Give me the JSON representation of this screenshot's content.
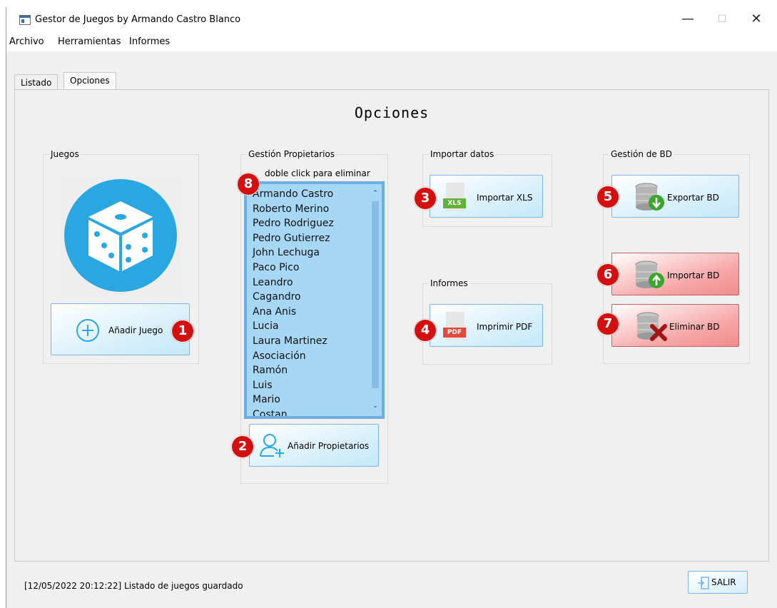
{
  "window": {
    "title": "Gestor de Juegos by Armando Castro Blanco",
    "minimize_glyph": "—",
    "maximize_glyph": "☐",
    "close_glyph": "✕"
  },
  "menu": [
    "Archivo",
    "Herramientas",
    "Informes"
  ],
  "tabs": [
    {
      "label": "Listado",
      "active": false
    },
    {
      "label": "Opciones",
      "active": true
    }
  ],
  "page": {
    "heading": "Opciones"
  },
  "groups": {
    "juegos": {
      "title": "Juegos",
      "add_button": "Añadir Juego",
      "badge": "1",
      "image_icon": "dice-icon"
    },
    "propietarios": {
      "title": "Gestión Propietarios",
      "hint": "doble click para eliminar",
      "badge": "8",
      "add_button": "Añadir Propietarios",
      "add_badge": "2",
      "owners": [
        "Armando Castro",
        "Roberto Merino",
        "Pedro Rodriguez",
        "Pedro Gutierrez",
        "John Lechuga",
        "Paco Pico",
        "Leandro",
        "Cagandro",
        "Ana Anis",
        "Lucia",
        "Laura Martinez",
        "Asociación",
        "Ramón",
        "Luis",
        "Mario",
        "Costan"
      ]
    },
    "importar": {
      "title": "Importar datos",
      "button": "Importar XLS",
      "badge": "3",
      "icon_text": "XLS"
    },
    "informes": {
      "title": "Informes",
      "button": "Imprimir PDF",
      "badge": "4",
      "icon_text": "PDF"
    },
    "bd": {
      "title": "Gestión de BD",
      "exportar": "Exportar BD",
      "exportar_badge": "5",
      "importar": "Importar BD",
      "importar_badge": "6",
      "eliminar": "Eliminar BD",
      "eliminar_badge": "7"
    }
  },
  "status": "[12/05/2022 20:12:22] Listado de juegos guardado",
  "exit_button": "SALIR",
  "colors": {
    "accent_blue": "#2aa6e0",
    "badge_red": "#d40f0f",
    "list_bg": "#a6d7f5",
    "danger_btn": "#f08c8c"
  }
}
